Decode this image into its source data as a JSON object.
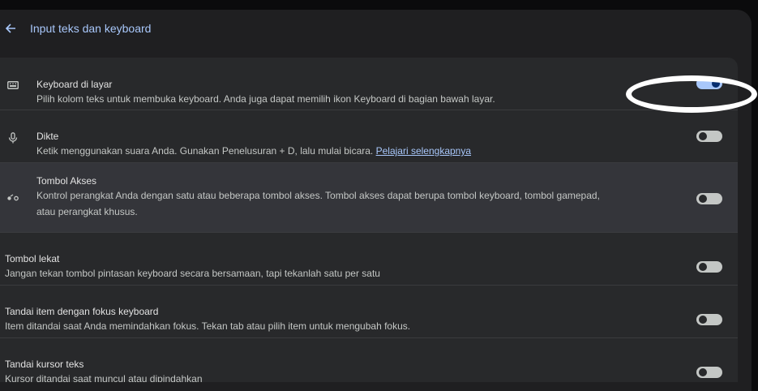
{
  "header": {
    "title": "Input teks dan keyboard"
  },
  "rows": [
    {
      "label": "Keyboard di layar",
      "desc": "Pilih kolom teks untuk membuka keyboard. Anda juga dapat memilih ikon Keyboard di bagian bawah layar.",
      "icon": "keyboard-icon",
      "on": true
    },
    {
      "label": "Dikte",
      "desc": "Ketik menggunakan suara Anda. Gunakan Penelusuran + D, lalu mulai bicara.",
      "link": "Pelajari selengkapnya",
      "icon": "microphone-icon",
      "on": false
    },
    {
      "label": "Tombol Akses",
      "desc": "Kontrol perangkat Anda dengan satu atau beberapa tombol akses. Tombol akses dapat berupa tombol keyboard, tombol gamepad,",
      "desc2": "atau perangkat khusus.",
      "icon": "switch-access-icon",
      "on": false
    },
    {
      "label": "Tombol lekat",
      "desc": "Jangan tekan tombol pintasan keyboard secara bersamaan, tapi tekanlah satu per satu",
      "on": false
    },
    {
      "label": "Tandai item dengan fokus keyboard",
      "desc": "Item ditandai saat Anda memindahkan fokus. Tekan tab atau pilih item untuk mengubah fokus.",
      "on": false
    },
    {
      "label": "Tandai kursor teks",
      "desc": "Kursor ditandai saat muncul atau dipindahkan",
      "on": false
    }
  ],
  "icons": {
    "back": "arrow-left-icon"
  },
  "colors": {
    "accent": "#a8c7fa",
    "background": "#1f1f21",
    "card": "#28292b",
    "annotation": "#ffffff"
  }
}
